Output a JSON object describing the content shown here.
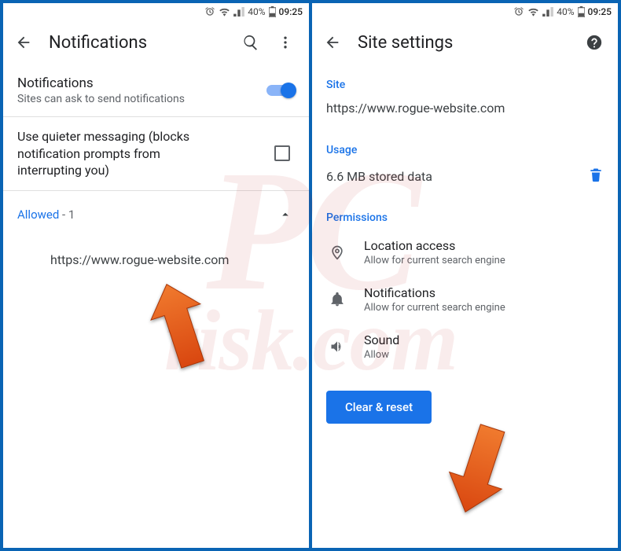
{
  "statusbar": {
    "battery_pct": "40%",
    "time": "09:25"
  },
  "left": {
    "title": "Notifications",
    "notif_row": {
      "primary": "Notifications",
      "secondary": "Sites can ask to send notifications"
    },
    "quiet_row": {
      "primary": "Use quieter messaging (blocks notification prompts from interrupting you)"
    },
    "allowed": {
      "label": "Allowed",
      "count_sep": " - ",
      "count": "1"
    },
    "site": "https://www.rogue-website.com"
  },
  "right": {
    "title": "Site settings",
    "sections": {
      "site": "Site",
      "usage": "Usage",
      "permissions": "Permissions"
    },
    "site_url": "https://www.rogue-website.com",
    "usage_text": "6.6 MB stored data",
    "perms": {
      "location": {
        "primary": "Location access",
        "secondary": "Allow for current search engine"
      },
      "notifications": {
        "primary": "Notifications",
        "secondary": "Allow for current search engine"
      },
      "sound": {
        "primary": "Sound",
        "secondary": "Allow"
      }
    },
    "clear_btn": "Clear & reset"
  },
  "colors": {
    "accent": "#1a73e8",
    "frame": "#0a64b4",
    "arrow": "#e85a17"
  }
}
